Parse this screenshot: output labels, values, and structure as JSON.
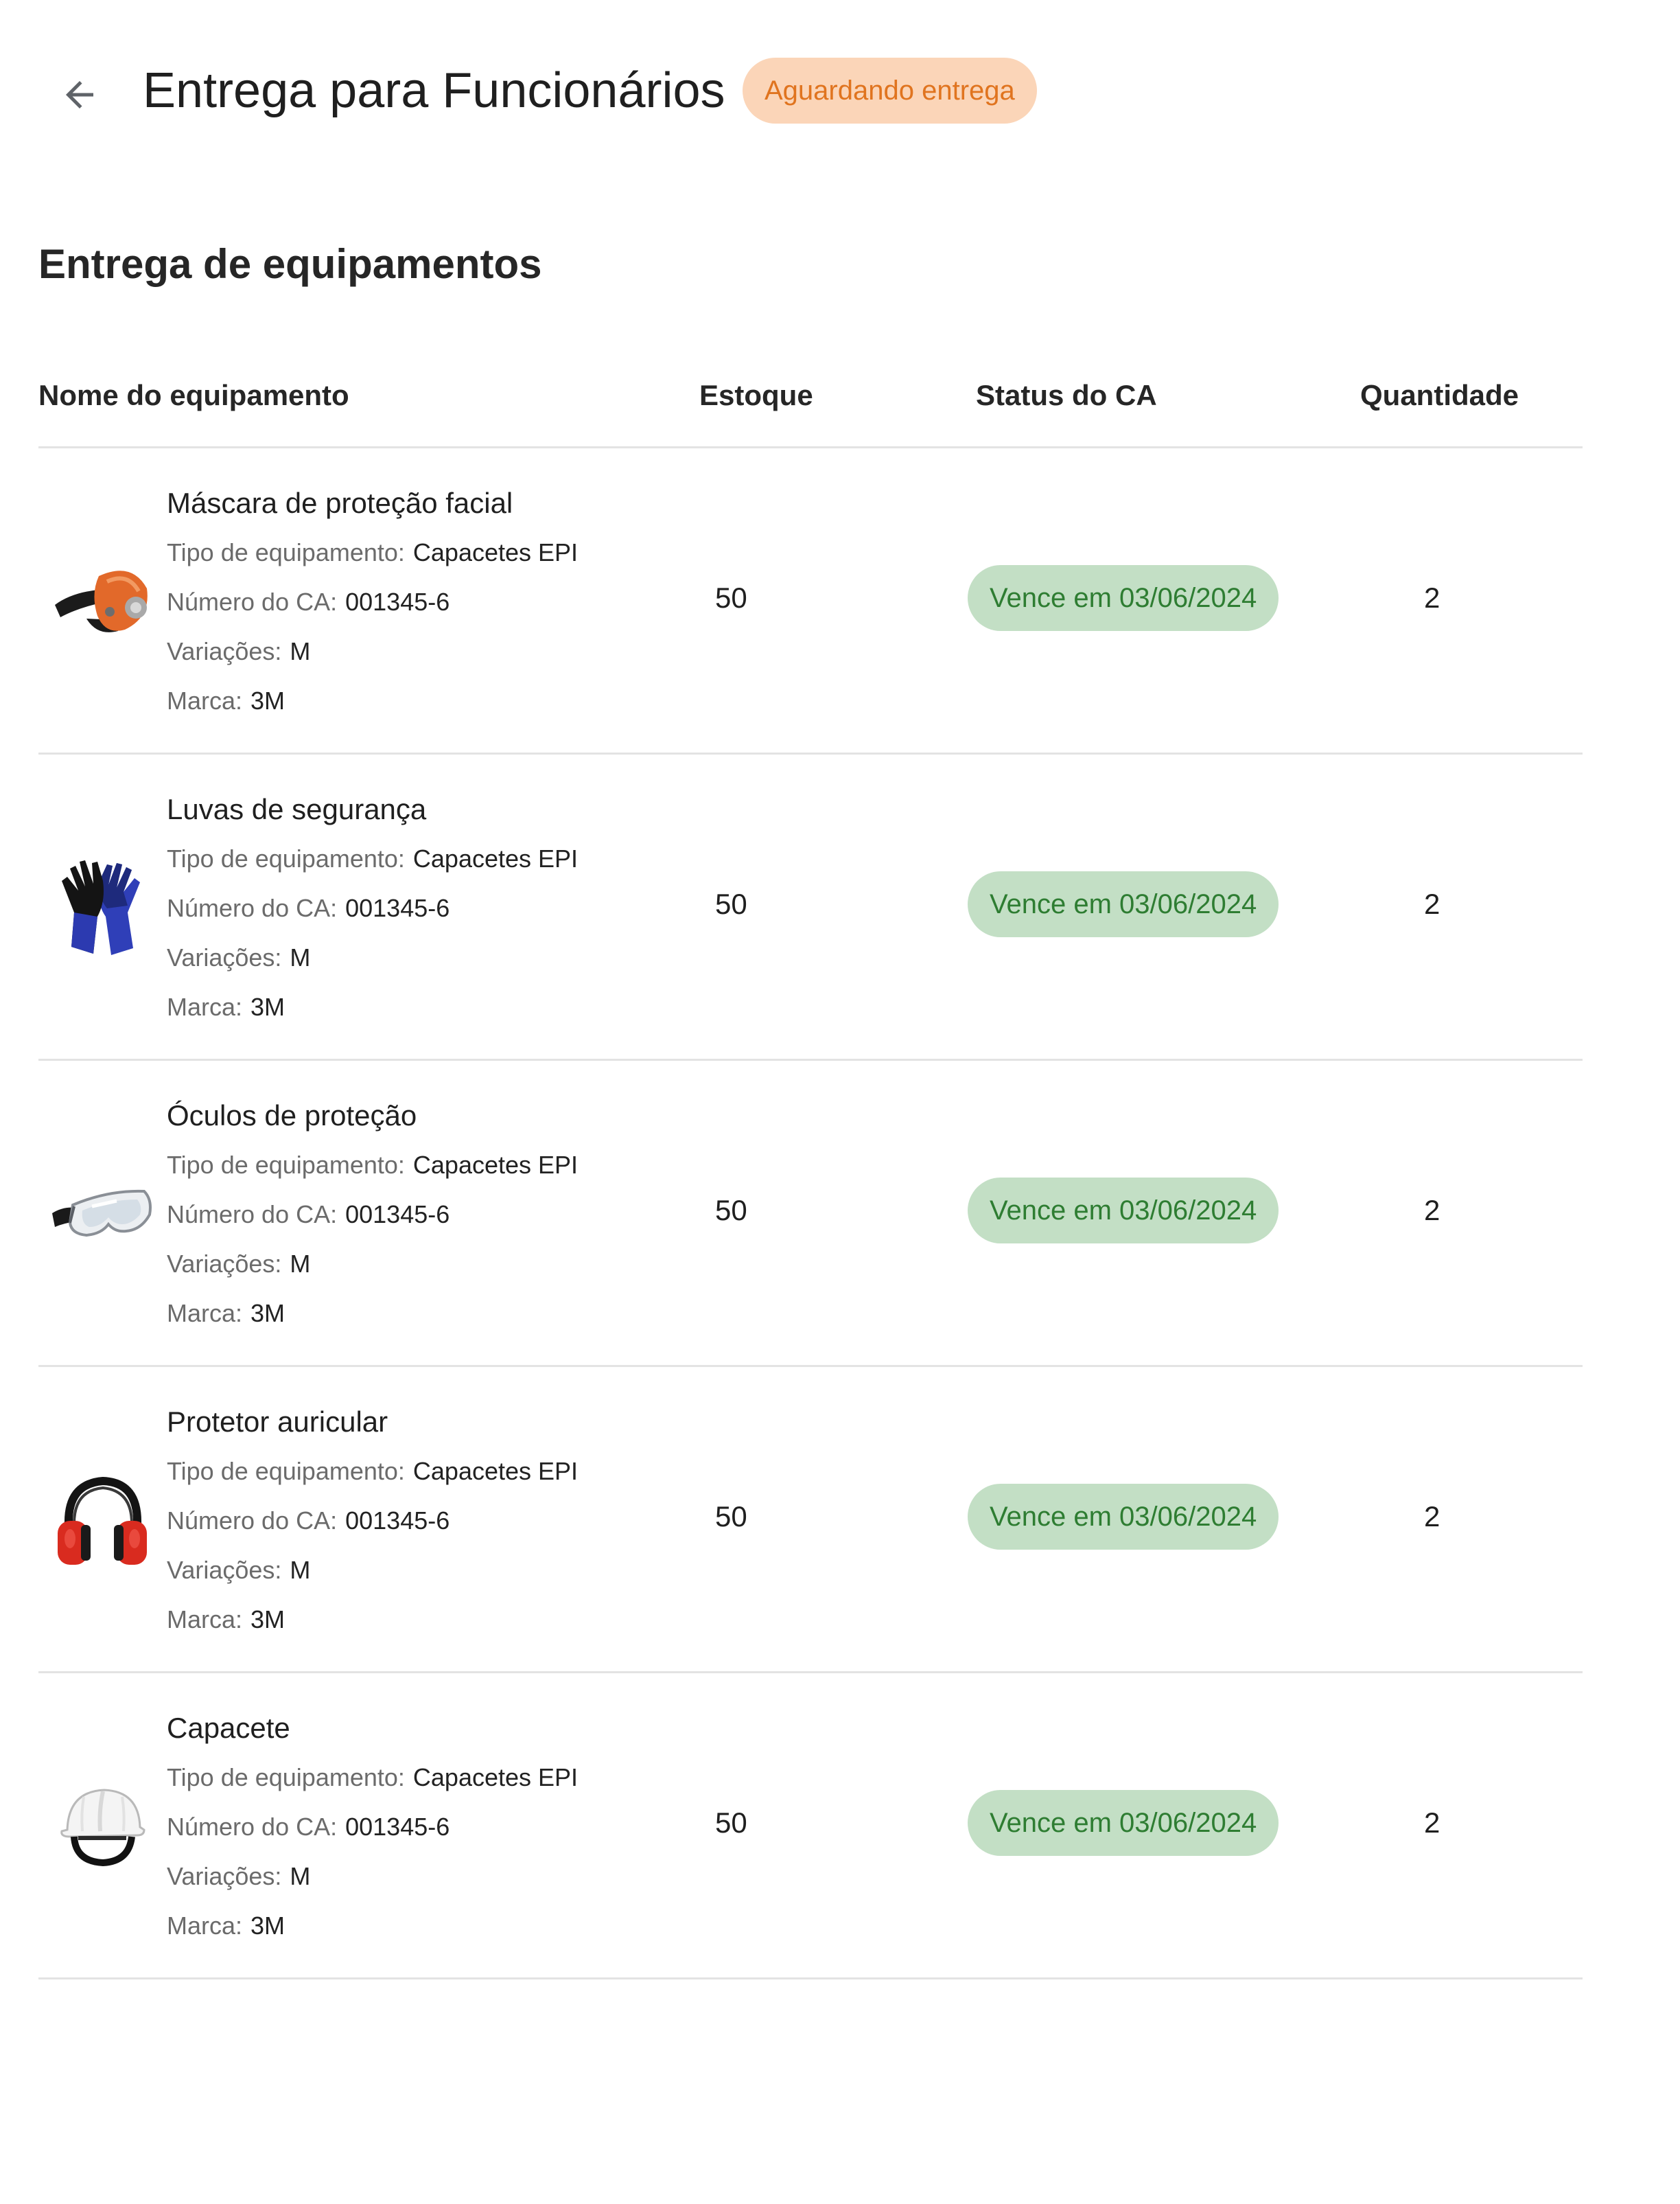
{
  "header": {
    "title": "Entrega para Funcionários",
    "status": "Aguardando entrega",
    "back_icon": "arrow-left-icon"
  },
  "section": {
    "title": "Entrega de equipamentos"
  },
  "table": {
    "columns": {
      "name": "Nome do equipamento",
      "stock": "Estoque",
      "ca_status": "Status do CA",
      "quantity": "Quantidade"
    },
    "labels": {
      "type": "Tipo de equipamento:",
      "ca_number": "Número do CA:",
      "variations": "Variações:",
      "brand": "Marca:"
    },
    "rows": [
      {
        "name": "Máscara de proteção facial",
        "image": "face-mask-icon",
        "type": "Capacetes EPI",
        "ca_number": "001345-6",
        "variations": "M",
        "brand": "3M",
        "stock": "50",
        "ca_status": "Vence em 03/06/2024",
        "quantity": "2"
      },
      {
        "name": "Luvas de segurança",
        "image": "gloves-icon",
        "type": "Capacetes EPI",
        "ca_number": "001345-6",
        "variations": "M",
        "brand": "3M",
        "stock": "50",
        "ca_status": "Vence em 03/06/2024",
        "quantity": "2"
      },
      {
        "name": "Óculos de proteção",
        "image": "goggles-icon",
        "type": "Capacetes EPI",
        "ca_number": "001345-6",
        "variations": "M",
        "brand": "3M",
        "stock": "50",
        "ca_status": "Vence em 03/06/2024",
        "quantity": "2"
      },
      {
        "name": "Protetor auricular",
        "image": "ear-protector-icon",
        "type": "Capacetes EPI",
        "ca_number": "001345-6",
        "variations": "M",
        "brand": "3M",
        "stock": "50",
        "ca_status": "Vence em 03/06/2024",
        "quantity": "2"
      },
      {
        "name": "Capacete",
        "image": "helmet-icon",
        "type": "Capacetes EPI",
        "ca_number": "001345-6",
        "variations": "M",
        "brand": "3M",
        "stock": "50",
        "ca_status": "Vence em 03/06/2024",
        "quantity": "2"
      }
    ]
  },
  "colors": {
    "status_bg": "#fbd5b8",
    "status_text": "#e0741f",
    "ca_bg": "#c3dfc5",
    "ca_text": "#2e7d32",
    "divider": "#e3e3e3"
  }
}
